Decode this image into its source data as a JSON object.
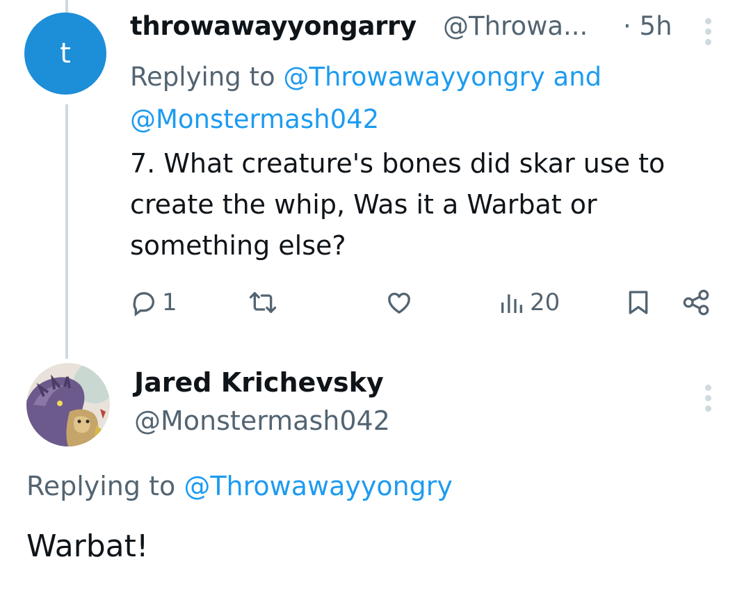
{
  "tweet1": {
    "avatar_letter": "t",
    "display_name": "throwawayyongarry",
    "handle": "@Throwa...",
    "time": "· 5h",
    "replying_prefix": "Replying to ",
    "replying_to_1": "@Throwawayyongry",
    "replying_and": " and",
    "replying_to_2": "@Monstermash042",
    "text": "7. What creature's bones did skar use to create the whip, Was it a Warbat or something else?",
    "reply_count": "1",
    "views_count": "20"
  },
  "tweet2": {
    "display_name": "Jared Krichevsky",
    "handle": "@Monstermash042",
    "replying_prefix": "Replying to ",
    "replying_to": "@Throwawayyongry",
    "text": "Warbat!"
  },
  "colors": {
    "accent": "#1d9bf0",
    "avatar_bg": "#1d8ed8",
    "muted": "#536471",
    "thread_line": "#cfd9de"
  },
  "icons": [
    "reply-icon",
    "retweet-icon",
    "like-icon",
    "views-icon",
    "bookmark-icon",
    "share-icon",
    "more-icon"
  ]
}
